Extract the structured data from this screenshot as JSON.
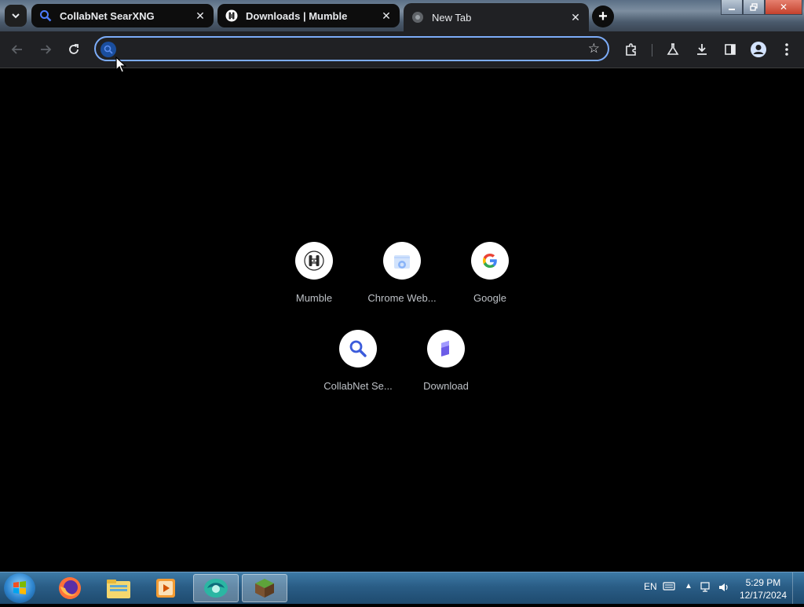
{
  "browser": {
    "tabs": [
      {
        "title": "CollabNet SearXNG",
        "favicon": "search-icon",
        "active": false
      },
      {
        "title": "Downloads | Mumble",
        "favicon": "mumble-icon",
        "active": false
      },
      {
        "title": "New Tab",
        "favicon": "globe-icon",
        "active": true
      }
    ],
    "omnibox": {
      "value": "",
      "placeholder": ""
    },
    "colors": {
      "accent": "#7cacf8",
      "toolbar": "#202124",
      "page_bg": "#000000"
    }
  },
  "shortcuts": [
    {
      "label": "Mumble",
      "icon": "mumble-icon"
    },
    {
      "label": "Chrome Web...",
      "icon": "chrome-web-store-icon"
    },
    {
      "label": "Google",
      "icon": "google-icon"
    },
    {
      "label": "CollabNet Se...",
      "icon": "search-icon"
    },
    {
      "label": "Download",
      "icon": "download-icon"
    }
  ],
  "taskbar": {
    "apps": [
      "firefox-icon",
      "file-explorer-icon",
      "media-player-icon",
      "browser-icon",
      "minecraft-icon"
    ],
    "tray": {
      "language": "EN",
      "time": "5:29 PM",
      "date": "12/17/2024"
    }
  }
}
